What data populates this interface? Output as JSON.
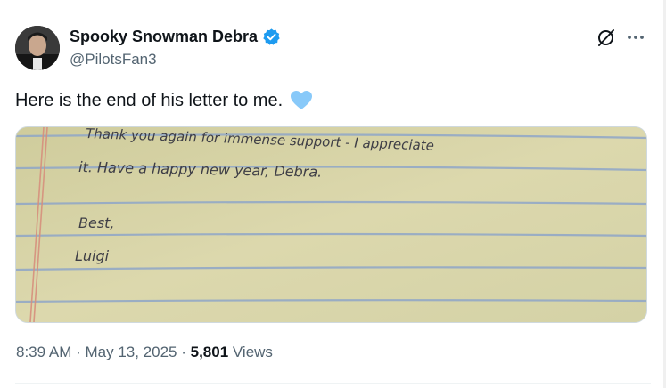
{
  "author": {
    "display_name": "Spooky Snowman Debra",
    "handle": "@PilotsFan3",
    "verified": true
  },
  "post": {
    "text": "Here is the end of his letter to me.",
    "emoji": "light-blue-heart"
  },
  "letter": {
    "line1": "Thank you again for immense support - I appreciate",
    "line2": "it. Have a happy new year, Debra.",
    "line3": "Best,",
    "line4": "Luigi"
  },
  "meta": {
    "time": "8:39 AM",
    "separator1": " · ",
    "date": "May 13, 2025",
    "separator2": " · ",
    "views_count": "5,801",
    "views_label": " Views"
  },
  "colors": {
    "verified": "#1d9bf0",
    "heart": "#88c9f9",
    "paper": "#d8d4a8",
    "rule_line": "#8fa6c8",
    "margin_line": "#d68f7d"
  }
}
